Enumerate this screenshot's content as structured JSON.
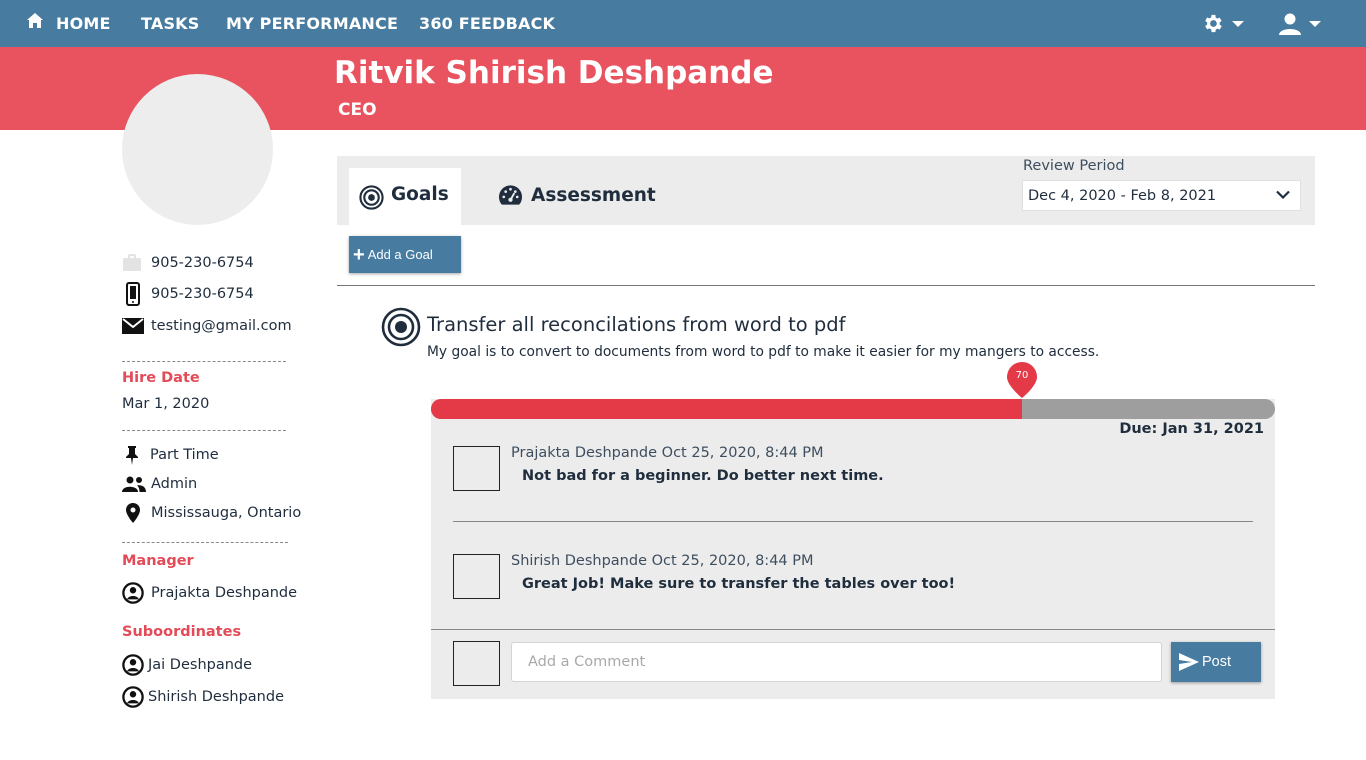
{
  "nav": {
    "home": "HOME",
    "tasks": "TASKS",
    "performance": "MY PERFORMANCE",
    "feedback": "360 FEEDBACK",
    "right_icons": [
      "gear-icon",
      "user-icon"
    ]
  },
  "profile": {
    "name": "Ritvik Shirish Deshpande",
    "title": "CEO",
    "work_phone": "905-230-6754",
    "mobile_phone": "905-230-6754",
    "email": "testing@gmail.com",
    "hire_date_label": "Hire Date",
    "hire_date": "Mar 1, 2020",
    "employment_type": "Part Time",
    "role": "Admin",
    "location": "Mississauga, Ontario",
    "manager_label": "Manager",
    "manager": "Prajakta Deshpande",
    "subordinates_label": "Suboordinates",
    "subordinates": [
      "Jai Deshpande",
      "Shirish Deshpande"
    ]
  },
  "tabs": {
    "goals": "Goals",
    "assessment": "Assessment"
  },
  "review": {
    "label": "Review Period",
    "selected": "Dec 4, 2020 - Feb 8, 2021"
  },
  "add_goal_label": "Add a Goal",
  "goal": {
    "title": "Transfer all reconcilations from word to pdf",
    "description": "My goal is to convert to documents from word to pdf to make it easier for my mangers to access.",
    "progress": 70,
    "progress_label": "70",
    "due": "Due: Jan 31, 2021"
  },
  "comments": [
    {
      "header": "Prajakta Deshpande Oct 25, 2020, 8:44 PM",
      "text": "Not bad for a beginner. Do better next time."
    },
    {
      "header": "Shirish Deshpande Oct 25, 2020, 8:44 PM",
      "text": "Great Job! Make sure to transfer the tables over too!"
    }
  ],
  "comment_input": {
    "placeholder": "Add a Comment",
    "value": ""
  },
  "post_label": "Post",
  "colors": {
    "nav": "#477ba0",
    "band": "#e8535f",
    "progress_fill": "#e43a48",
    "progress_track": "#9e9e9e",
    "accent_text": "#e24b57"
  }
}
